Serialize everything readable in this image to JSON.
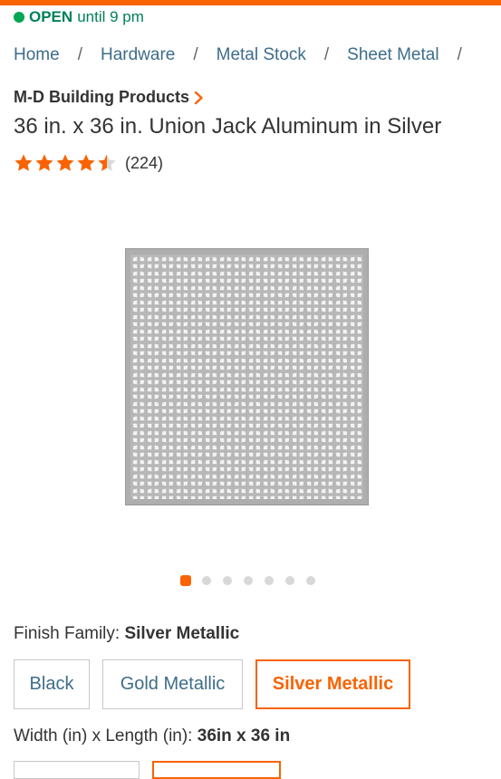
{
  "colors": {
    "brand_orange": "#f96302",
    "open_green": "#00805a",
    "link_blue": "#3d6d8a",
    "star_orange": "#f96302"
  },
  "store_status": {
    "status": "OPEN",
    "hours": "until 9 pm"
  },
  "breadcrumb": {
    "items": [
      "Home",
      "Hardware",
      "Metal Stock",
      "Sheet Metal"
    ],
    "separator": "/"
  },
  "product": {
    "brand": "M-D Building Products",
    "title": "36 in. x 36 in. Union Jack Aluminum in Silver",
    "rating": 4.5,
    "rating_icon": "star-icon",
    "review_count": "(224)",
    "image_alt": "union-jack-perforated-aluminum-sheet"
  },
  "carousel": {
    "total": 7,
    "active_index": 0
  },
  "finish": {
    "label": "Finish Family:",
    "selected": "Silver Metallic",
    "options": [
      "Black",
      "Gold Metallic",
      "Silver Metallic"
    ]
  },
  "size": {
    "label": "Width (in) x Length (in):",
    "selected": "36in x 36 in"
  }
}
